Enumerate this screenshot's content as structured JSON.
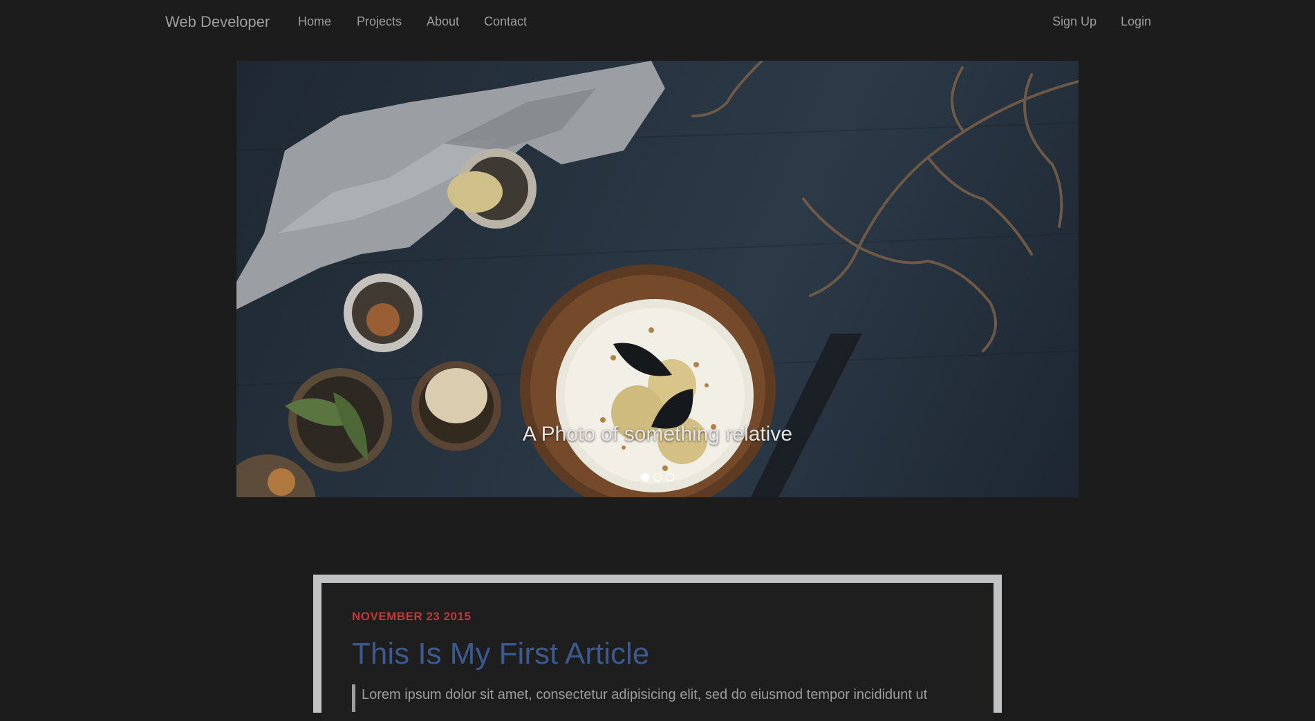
{
  "navbar": {
    "brand": "Web Developer",
    "left_links": [
      "Home",
      "Projects",
      "About",
      "Contact"
    ],
    "right_links": [
      "Sign Up",
      "Login"
    ]
  },
  "carousel": {
    "caption": "A Photo of something relative",
    "slide_count": 3,
    "active_slide": 1
  },
  "article": {
    "date": "NOVEMBER 23 2015",
    "title": "This Is My First Article",
    "excerpt": "Lorem ipsum dolor sit amet, consectetur adipisicing elit, sed do eiusmod tempor incididunt ut"
  },
  "colors": {
    "background": "#1c1c1c",
    "nav_text": "#9d9d9d",
    "date": "#c0393b",
    "title": "#3d5a8f",
    "article_border": "#bfc3c6"
  }
}
